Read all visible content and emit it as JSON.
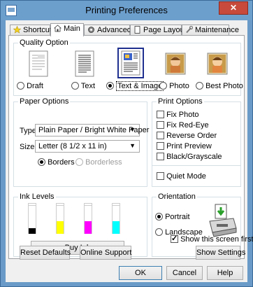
{
  "window": {
    "title": "Printing Preferences",
    "close_label": "✕"
  },
  "tabs": [
    {
      "label": "Shortcuts",
      "icon": "star-icon"
    },
    {
      "label": "Main",
      "icon": "home-icon",
      "active": true
    },
    {
      "label": "Advanced",
      "icon": "gear-icon"
    },
    {
      "label": "Page Layout",
      "icon": "page-icon"
    },
    {
      "label": "Maintenance",
      "icon": "wrench-icon"
    }
  ],
  "quality": {
    "legend": "Quality Option",
    "options": [
      {
        "label": "Draft",
        "selected": false
      },
      {
        "label": "Text",
        "selected": false
      },
      {
        "label": "Text & Image",
        "selected": true
      },
      {
        "label": "Photo",
        "selected": false
      },
      {
        "label": "Best Photo",
        "selected": false
      }
    ]
  },
  "paper": {
    "legend": "Paper Options",
    "type_label": "Type",
    "type_value": "Plain Paper / Bright White Paper",
    "size_label": "Size",
    "size_value": "Letter (8 1/2 x 11 in)",
    "borders_label": "Borders",
    "borderless_label": "Borderless"
  },
  "print_options": {
    "legend": "Print Options",
    "items": [
      {
        "label": "Fix Photo",
        "checked": false
      },
      {
        "label": "Fix Red-Eye",
        "checked": false
      },
      {
        "label": "Reverse Order",
        "checked": false
      },
      {
        "label": "Print Preview",
        "checked": false
      },
      {
        "label": "Black/Grayscale",
        "checked": false
      }
    ],
    "quiet_mode": {
      "label": "Quiet Mode",
      "checked": false
    }
  },
  "ink": {
    "legend": "Ink Levels",
    "levels": [
      {
        "color": "#000000",
        "level": 0.2
      },
      {
        "color": "#ffff00",
        "level": 0.45
      },
      {
        "color": "#ff00ff",
        "level": 0.45
      },
      {
        "color": "#00ffff",
        "level": 0.45
      }
    ],
    "buy_label": "Buy Ink"
  },
  "orientation": {
    "legend": "Orientation",
    "portrait_label": "Portrait",
    "landscape_label": "Landscape",
    "selected": "Portrait"
  },
  "show_screen": {
    "label": "Show this screen first",
    "checked": true
  },
  "buttons": {
    "reset": "Reset Defaults",
    "support": "Online Support",
    "show_settings": "Show Settings",
    "ok": "OK",
    "cancel": "Cancel",
    "help": "Help"
  }
}
